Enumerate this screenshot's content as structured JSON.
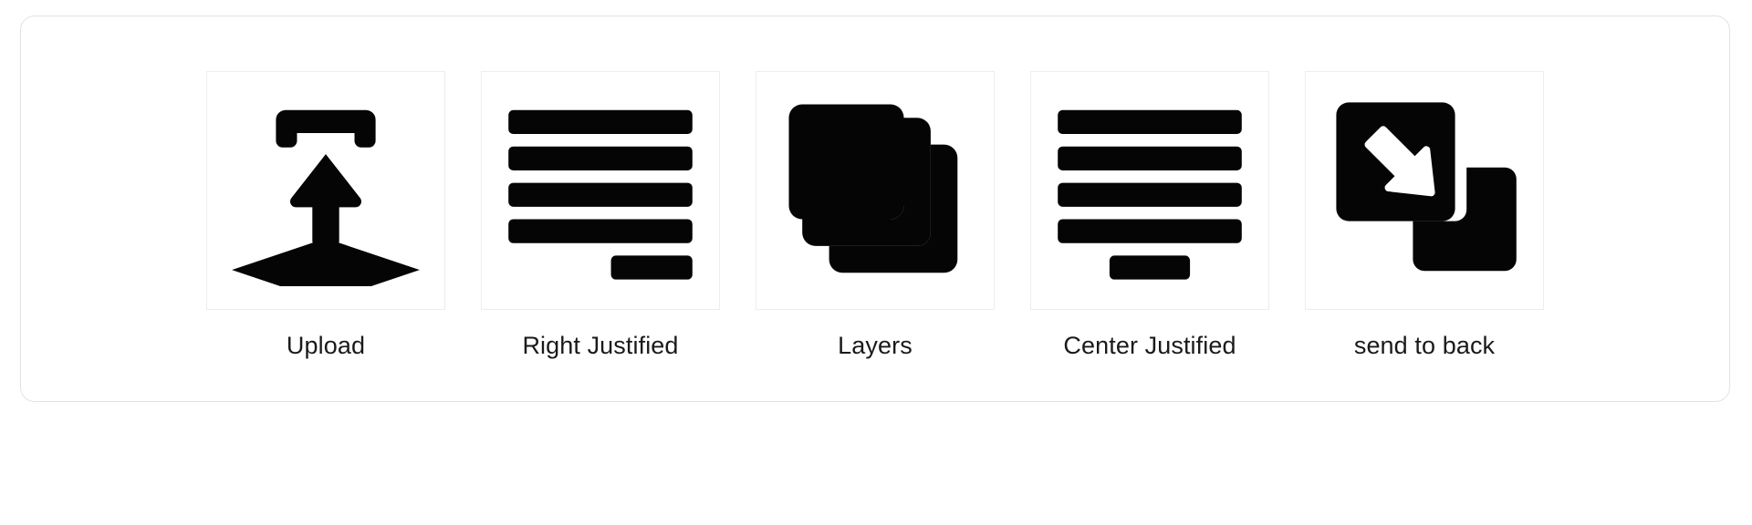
{
  "board": {
    "border_color": "#e3e3e3",
    "background_color": "#ffffff",
    "icon_color": "#050505",
    "frame_border_color": "#ededed",
    "label_color": "#1a1a1a"
  },
  "icons": [
    {
      "id": "upload",
      "label": "Upload",
      "icon_name": "upload-icon",
      "description": "bracket above an up arrow over a flat diamond platform"
    },
    {
      "id": "right-justified",
      "label": "Right Justified",
      "icon_name": "right-justified-icon",
      "description": "four full-width bars and one short bar aligned to the right"
    },
    {
      "id": "layers",
      "label": "Layers",
      "icon_name": "layers-icon",
      "description": "three stacked rounded squares offset diagonally"
    },
    {
      "id": "center-justified",
      "label": "Center Justified",
      "icon_name": "center-justified-icon",
      "description": "four full-width bars and one short bar centered"
    },
    {
      "id": "send-to-back",
      "label": "send to back",
      "icon_name": "send-to-back-icon",
      "description": "rounded square with white diagonal arrow pointing down-right, overlapping square behind"
    }
  ]
}
